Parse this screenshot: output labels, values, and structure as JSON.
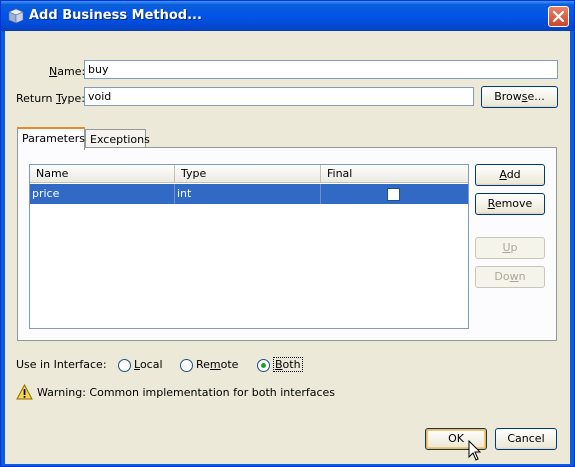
{
  "window": {
    "title": "Add Business Method..."
  },
  "form": {
    "name_label_pre": "",
    "name_label_mn": "N",
    "name_label_post": "ame:",
    "name_value": "buy",
    "return_label_pre": "Return ",
    "return_label_mn": "T",
    "return_label_post": "ype:",
    "return_value": "void",
    "browse_pre": "Brow",
    "browse_mn": "s",
    "browse_post": "e..."
  },
  "tabs": [
    {
      "label": "Parameters",
      "active": true
    },
    {
      "label": "Exceptions",
      "active": false
    }
  ],
  "table": {
    "columns": [
      "Name",
      "Type",
      "Final"
    ],
    "rows": [
      {
        "name": "price",
        "type": "int",
        "final": false
      }
    ]
  },
  "side_buttons": {
    "add_mn": "A",
    "add_post": "dd",
    "remove_mn": "R",
    "remove_post": "emove",
    "up_mn": "U",
    "up_post": "p",
    "down_pre": "Do",
    "down_mn": "w",
    "down_post": "n"
  },
  "interface": {
    "label": "Use in Interface:",
    "local_mn": "L",
    "local_post": "ocal",
    "remote_pre": "Re",
    "remote_mn": "m",
    "remote_post": "ote",
    "both_mn": "B",
    "both_post": "oth",
    "selected": "Both"
  },
  "warning": {
    "text": "Warning: Common implementation for both interfaces"
  },
  "footer": {
    "ok_label": "OK",
    "cancel_label": "Cancel"
  },
  "colors": {
    "title_bar": "#0a5fd8",
    "selection": "#316ac5",
    "dialog_bg": "#ece9d8",
    "tab_highlight": "#e68b2c"
  }
}
